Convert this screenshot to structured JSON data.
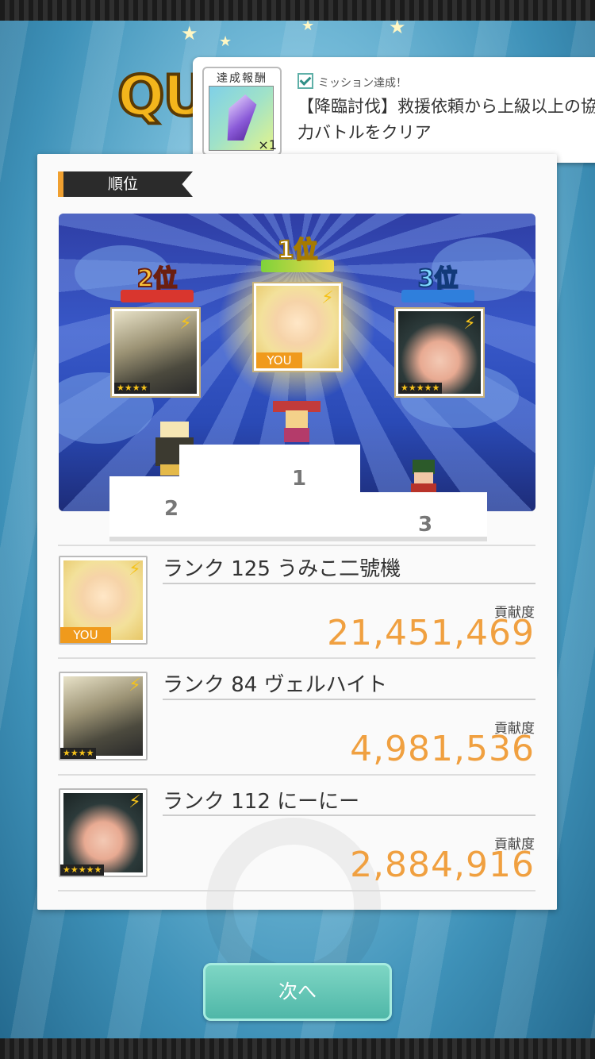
{
  "quest_title": "QU",
  "mission": {
    "reward_label": "達成報酬",
    "reward_qty": "×1",
    "reward_icon": "crystal-icon",
    "status": "ミッション達成！",
    "text": "【降臨討伐】救援依頼から上級以上の協力バトルをクリア"
  },
  "section": {
    "label": "順位"
  },
  "podium": {
    "first_label": "1位",
    "second_label": "2位",
    "third_label": "3位",
    "you_tag": "YOU",
    "second_stars": "★★★★",
    "third_stars": "★★★★★",
    "stand_1": "1",
    "stand_2": "2",
    "stand_3": "3"
  },
  "rankings": [
    {
      "name": "ランク 125 うみこ二號機",
      "label": "貢献度",
      "score": "21,451,469",
      "tag": "YOU"
    },
    {
      "name": "ランク 84 ヴェルハイト",
      "label": "貢献度",
      "score": "4,981,536",
      "tag": "★★★★"
    },
    {
      "name": "ランク 112 にーにー",
      "label": "貢献度",
      "score": "2,884,916",
      "tag": "★★★★★"
    }
  ],
  "next_button": "次へ",
  "colors": {
    "accent": "#f0a040",
    "button": "#5cc4b4",
    "panel": "#fafafa"
  }
}
